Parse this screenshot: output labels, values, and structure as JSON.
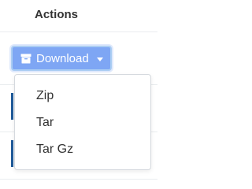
{
  "header": {
    "title": "Actions"
  },
  "download_button": {
    "label": "Download",
    "icon": "archive-icon",
    "caret_icon": "caret-down-icon"
  },
  "menu": {
    "items": [
      {
        "label": "Zip"
      },
      {
        "label": "Tar"
      },
      {
        "label": "Tar Gz"
      }
    ]
  },
  "colors": {
    "button_bg": "#7ea6f4",
    "button_border": "#aacdf3",
    "divider": "#e9ecef",
    "text": "#333333"
  }
}
